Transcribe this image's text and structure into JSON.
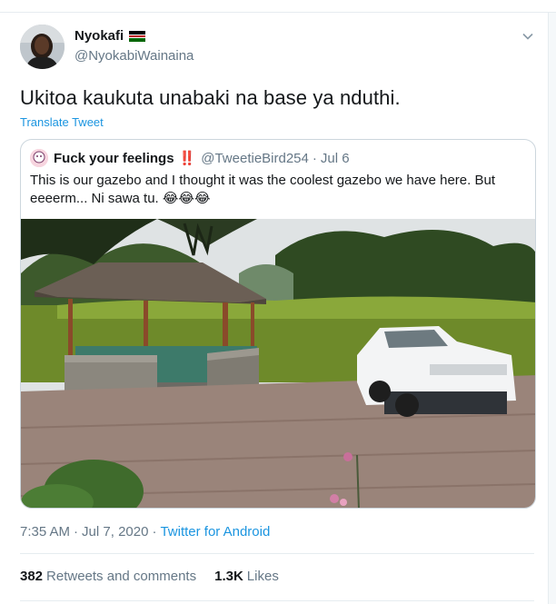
{
  "tweet": {
    "display_name": "Nyokafi",
    "handle": "@NyokabiWainaina",
    "flag_icon": "kenya-flag-icon",
    "text": "Ukitoa kaukuta unabaki na base ya nduthi.",
    "translate_label": "Translate Tweet",
    "time": "7:35 AM",
    "date": "Jul 7, 2020",
    "separator": "·",
    "source": "Twitter for Android",
    "retweets_count": "382",
    "retweets_label": "Retweets and comments",
    "likes_count": "1.3K",
    "likes_label": "Likes"
  },
  "quote": {
    "display_name": "Fuck your feelings",
    "emoji": "‼️",
    "handle": "@TweetieBird254",
    "separator": "·",
    "date": "Jul 6",
    "text": "This is our gazebo and I thought it was the coolest gazebo we have here. But eeeerm... Ni sawa tu. 😂😂😂"
  },
  "colors": {
    "link": "#1b95e0",
    "secondary_text": "#657786",
    "primary_text": "#14171a",
    "border": "#ccd6dd"
  }
}
